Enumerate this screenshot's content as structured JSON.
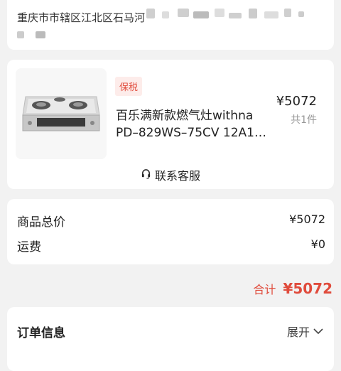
{
  "address": {
    "text": "重庆市市辖区江北区石马河"
  },
  "product": {
    "tag": "保税",
    "title_line1": "百乐满新款燃气灶withna",
    "title_line2": "PD–829WS–75CV 12A1…",
    "price": "¥5072",
    "quantity": "共1件",
    "customer_service": "联系客服",
    "image_icon": "gas-stove-image",
    "service_icon": "headset-icon"
  },
  "totals": {
    "goods_label": "商品总价",
    "goods_value": "¥5072",
    "shipping_label": "运费",
    "shipping_value": "¥0"
  },
  "grand_total": {
    "label": "合计",
    "value": "¥5072"
  },
  "order_info": {
    "title": "订单信息",
    "expand_label": "展开",
    "expand_icon": "chevron-down-icon"
  },
  "colors": {
    "accent": "#e04b3c",
    "background": "#f2f2f2"
  }
}
